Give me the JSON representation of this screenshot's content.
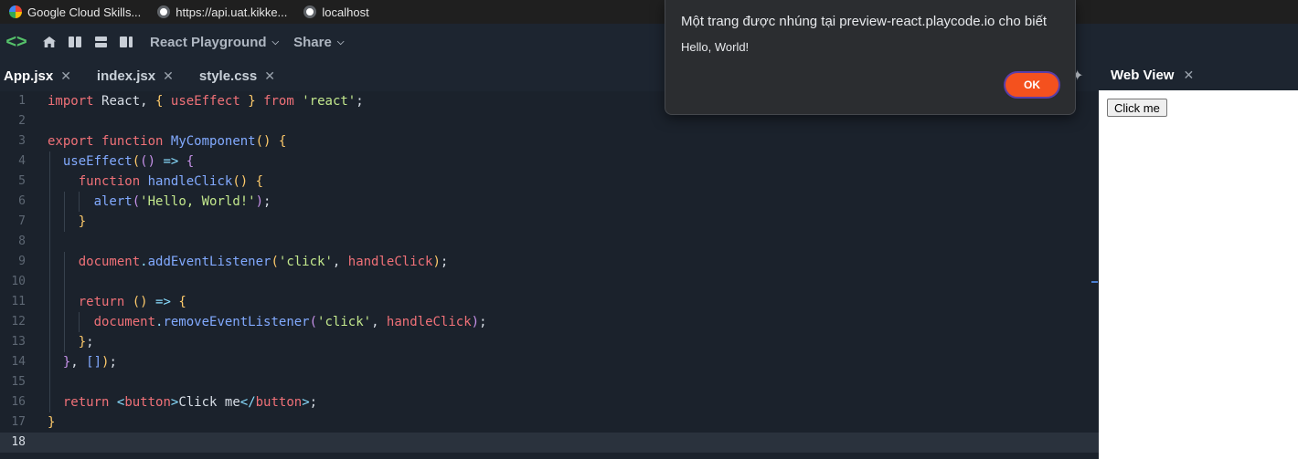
{
  "bookmarks": [
    {
      "label": "Google Cloud Skills...",
      "icon": "google-cloud-icon"
    },
    {
      "label": "https://api.uat.kikke...",
      "icon": "globe-icon"
    },
    {
      "label": "localhost",
      "icon": "globe-icon"
    }
  ],
  "toolbar": {
    "project_menu": "React Playground",
    "share_menu": "Share"
  },
  "tabs": [
    {
      "label": "App.jsx",
      "active": true
    },
    {
      "label": "index.jsx",
      "active": false
    },
    {
      "label": "style.css",
      "active": false
    }
  ],
  "editor": {
    "current_line": 18,
    "line_numbers": [
      "1",
      "2",
      "3",
      "4",
      "5",
      "6",
      "7",
      "8",
      "9",
      "10",
      "11",
      "12",
      "13",
      "14",
      "15",
      "16",
      "17",
      "18"
    ]
  },
  "webview": {
    "title": "Web View",
    "button_label": "Click me"
  },
  "dialog": {
    "title": "Một trang được nhúng tại preview-react.playcode.io cho biết",
    "message": "Hello, World!",
    "ok_label": "OK"
  },
  "colors": {
    "accent_ok": "#f4511e",
    "editor_bg": "#1b222c",
    "logo_green": "#55c16a"
  }
}
